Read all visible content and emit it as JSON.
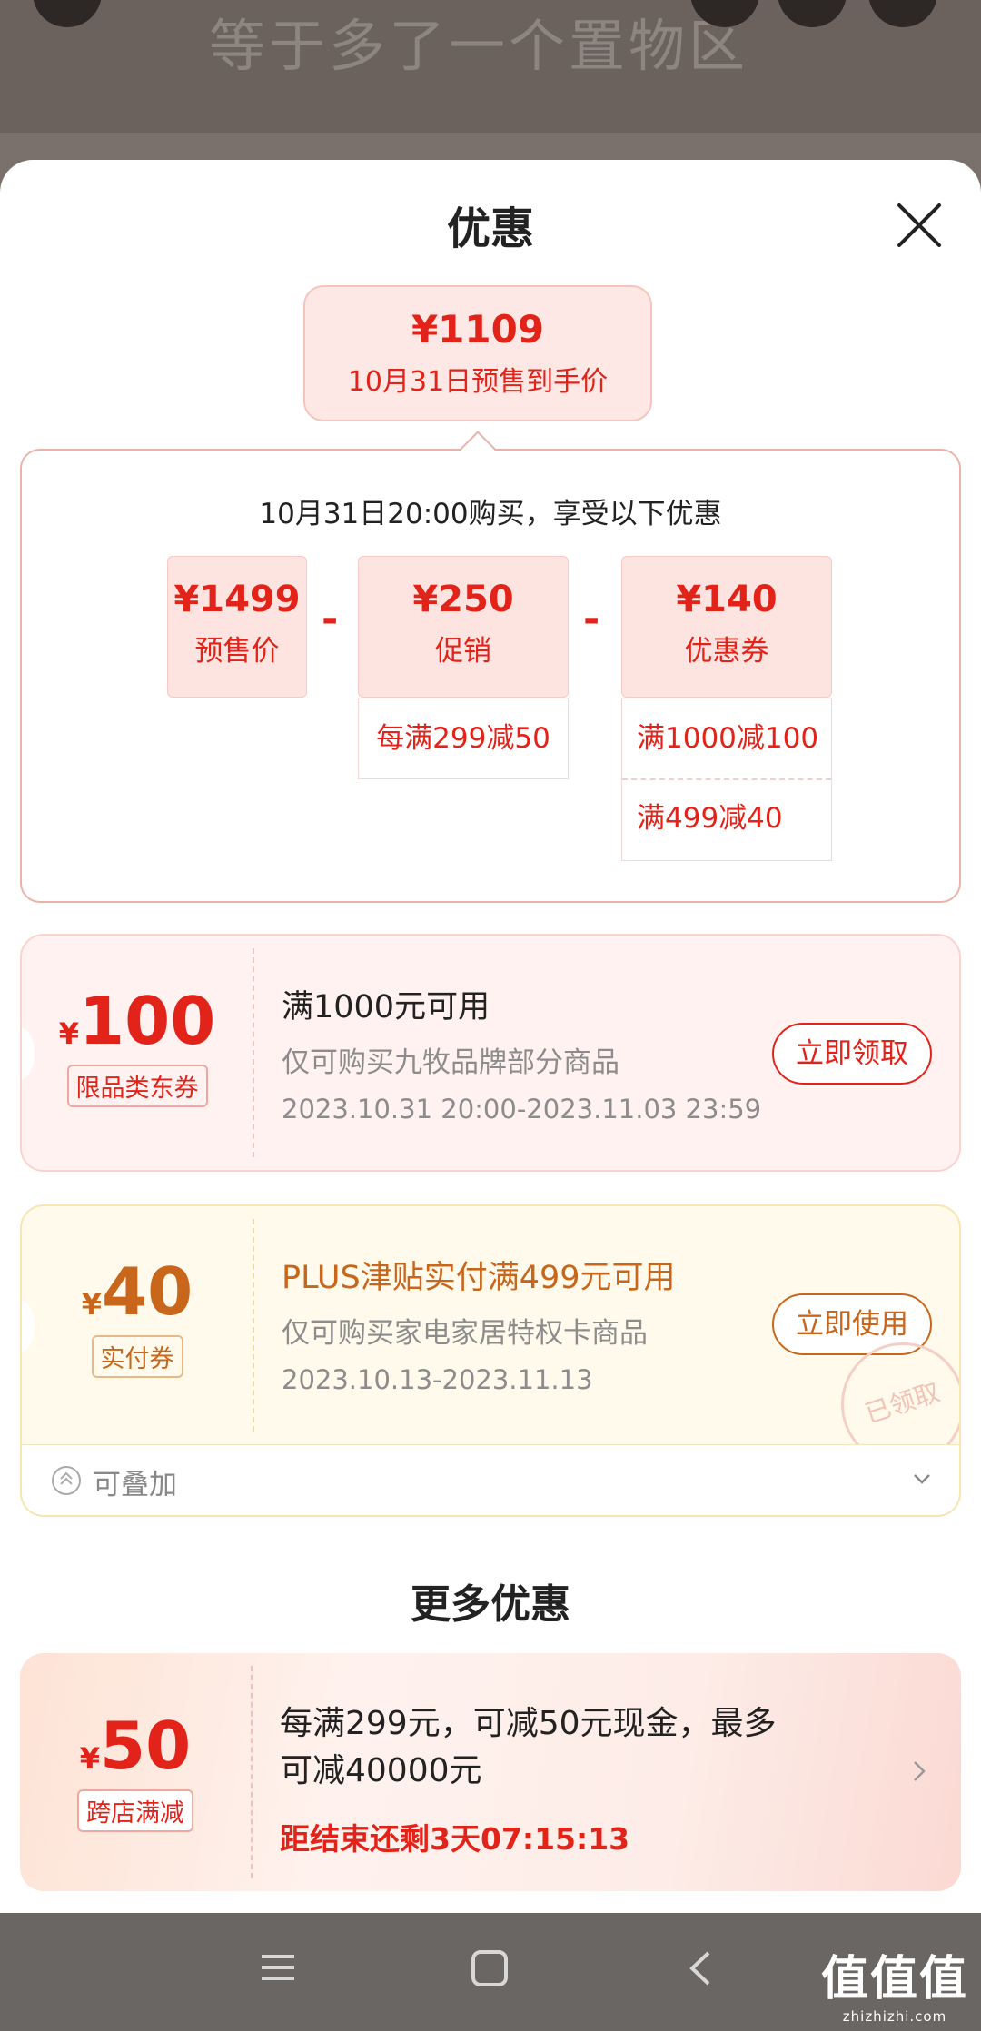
{
  "background": {
    "title": "等于多了一个置物区"
  },
  "sheet": {
    "title": "优惠"
  },
  "price_bubble": {
    "amount": "¥1109",
    "label": "10月31日预售到手价"
  },
  "breakdown": {
    "heading": "10月31日20:00购买，享受以下优惠",
    "items": [
      {
        "value": "¥1499",
        "label": "预售价"
      },
      {
        "value": "¥250",
        "label": "促销"
      },
      {
        "value": "¥140",
        "label": "优惠券"
      }
    ],
    "operator": "-",
    "promo_details": [
      "每满299减50"
    ],
    "coupon_details": [
      "满1000减100",
      "满499减40"
    ]
  },
  "coupons": [
    {
      "currency": "¥",
      "amount": "100",
      "tag": "限品类东券",
      "title": "满1000元可用",
      "desc": "仅可购买九牧品牌部分商品",
      "period": "2023.10.31 20:00-2023.11.03 23:59",
      "action": "立即领取"
    },
    {
      "currency": "¥",
      "amount": "40",
      "tag": "实付券",
      "title": "PLUS津贴实付满499元可用",
      "desc": "仅可购买家电家居特权卡商品",
      "period": "2023.10.13-2023.11.13",
      "action": "立即使用",
      "stamp": "已领取"
    }
  ],
  "stackable": {
    "label": "可叠加"
  },
  "more": {
    "title": "更多优惠",
    "card": {
      "currency": "¥",
      "amount": "50",
      "tag": "跨店满减",
      "title": "每满299元，可减50元现金，最多可减40000元",
      "countdown": "距结束还剩3天07:15:13"
    }
  },
  "watermark": {
    "title": "值值值",
    "url": "zhizhizhi.com"
  },
  "colors": {
    "accent": "#e2231a",
    "gold": "#c8661c",
    "coupon_pink": "#fff2f1",
    "coupon_yellow": "#fffaeb"
  }
}
